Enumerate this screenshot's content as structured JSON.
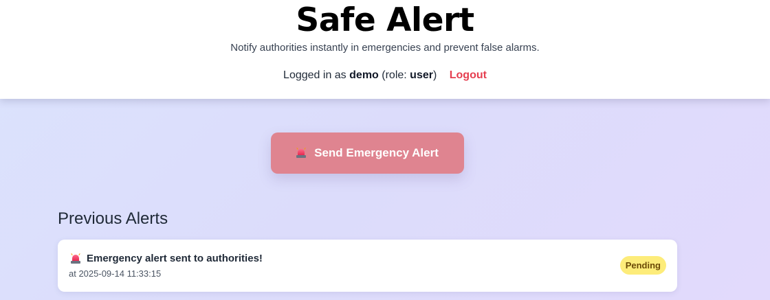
{
  "header": {
    "title": "Safe Alert",
    "subtitle": "Notify authorities instantly in emergencies and prevent false alarms.",
    "user": {
      "prefix": "Logged in as",
      "username": "demo",
      "role_prefix": "(role:",
      "role": "user",
      "role_suffix": ")",
      "logout_label": "Logout"
    }
  },
  "main": {
    "send_button_label": "Send Emergency Alert",
    "send_button_icon": "siren-icon",
    "previous_alerts_title": "Previous Alerts",
    "alerts": [
      {
        "icon": "siren-icon",
        "message": "Emergency alert sent to authorities!",
        "time": "at 2025-09-14 11:33:15",
        "status": "Pending"
      }
    ]
  },
  "colors": {
    "accent_red": "#e53e4f",
    "send_button_bg": "#df8490",
    "pending_badge_bg": "#fdec7a",
    "background_start": "#dbe3fd",
    "background_end": "#e2dafc"
  }
}
